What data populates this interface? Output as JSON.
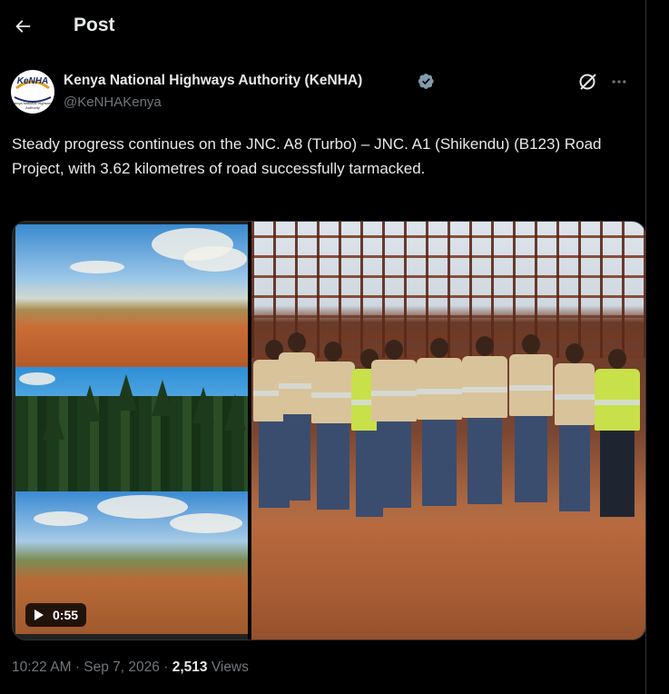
{
  "header": {
    "title": "Post",
    "back_icon": "arrow-left-icon"
  },
  "author": {
    "name": "Kenya National Highways Authority (KeNHA)",
    "handle": "@KeNHAKenya",
    "verified": true,
    "avatar_text": "KeNHA",
    "avatar_subtext": "Kenya National Highways Authority"
  },
  "actions": {
    "grok_icon": "grok-icon",
    "more_icon": "more-horizontal-icon"
  },
  "post": {
    "text": "Steady progress continues on the JNC. A8 (Turbo) – JNC. A1 (Shikendu) (B123) Road Project, with 3.62 kilometres of road successfully tarmacked."
  },
  "media": {
    "video": {
      "duration": "0:55",
      "play_icon": "play-icon"
    },
    "photo": {
      "description_icon": "image"
    }
  },
  "meta": {
    "time": "10:22 AM",
    "date": "Sep 7, 2026",
    "views_count": "2,513",
    "views_label": "Views",
    "separator": "·"
  },
  "colors": {
    "background": "#000000",
    "text": "#e7e9ea",
    "secondary": "#71767b",
    "verified": "#829aab"
  }
}
